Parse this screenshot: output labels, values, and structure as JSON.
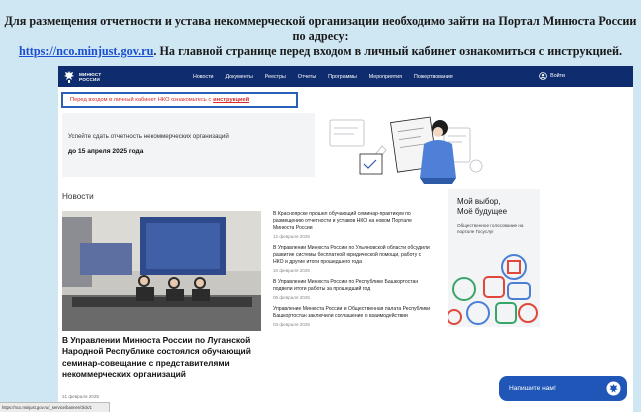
{
  "instruction": {
    "line1": "Для размещения отчетности и устава некоммерческой организации необходимо зайти на Портал Минюста России по адресу:",
    "link": "https://nco.minjust.gov.ru",
    "line2_rest": ". На главной странице перед входом в личный кабинет ознакомиться с инструкцией."
  },
  "site": {
    "logo": {
      "line1": "МИНЮСТ",
      "line2": "РОССИИ"
    },
    "nav": [
      "Новости",
      "Документы",
      "Реестры",
      "Отчеты",
      "Программы",
      "Мероприятия",
      "Пожертвования"
    ],
    "login": "Войти",
    "notice": {
      "text": "Перед входом в личный кабинет НКО ознакомьтесь с",
      "link": "инструкцией"
    },
    "banner": {
      "text": "Успейте сдать отчетность некоммерческих организаций",
      "date": "до 15 апреля 2025 года"
    },
    "news_heading": "Новости",
    "main_news": {
      "title": "В Управлении Минюста России по Луганской Народной Республике состоялся обучающий семинар-совещание с представителями некоммерческих организаций",
      "date": "21 февраля 2025"
    },
    "news_list": [
      {
        "title": "В Красноярске прошел обучающий семинар-практикум по размещению отчетности и уставов НКО на новом Портале Минюста России",
        "date": "12 февраля 2025"
      },
      {
        "title": "В Управлении Минюста России по Ульяновской области обсудили развитие системы бесплатной юридической помощи, работу с НКО и другие итоги прошедшего года",
        "date": "10 февраля 2025"
      },
      {
        "title": "В Управлении Минюста России по Республике Башкортостан подвели итоги работы за прошедший год",
        "date": "06 февраля 2025"
      },
      {
        "title": "Управление Минюста России и Общественная палата Республики Башкортостан заключили соглашение о взаимодействии",
        "date": "03 февраля 2025"
      }
    ],
    "promo": {
      "title": "Мой выбор,\nМоё будущее",
      "text": "Общественное голосование на портале Госуслуг"
    }
  },
  "status_url": "https://nco.minjust.gov.ru/_service/banner/click/1",
  "chat_button": "Напишите нам!",
  "colors": {
    "navbar": "#0f2d6e",
    "notice_border": "#2a5fb8",
    "notice_text": "#d62828",
    "chat": "#1f56b8",
    "background": "#cfe6f3"
  }
}
